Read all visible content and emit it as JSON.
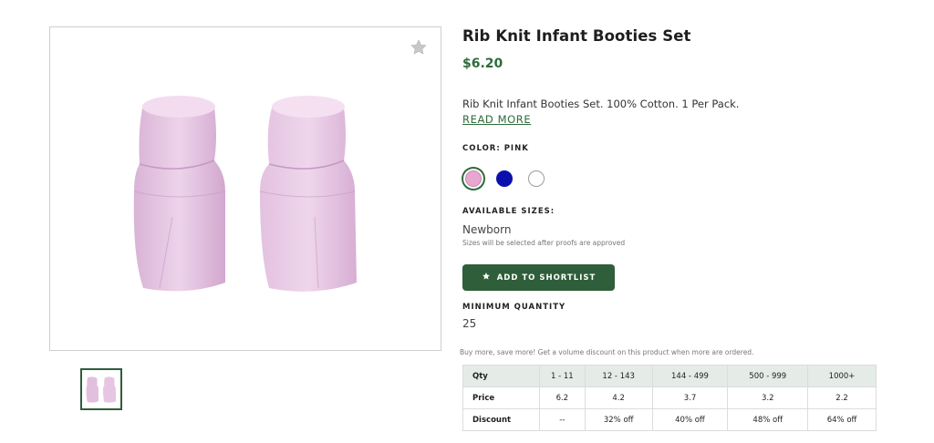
{
  "product": {
    "title": "Rib Knit Infant Booties Set",
    "price": "$6.20",
    "description": "Rib Knit Infant Booties Set. 100% Cotton. 1 Per Pack.",
    "read_more": "READ MORE"
  },
  "color": {
    "label": "COLOR: PINK",
    "swatches": [
      {
        "name": "pink",
        "hex": "#e8a7cf",
        "selected": true
      },
      {
        "name": "royal-blue",
        "hex": "#0a0fae",
        "selected": false
      },
      {
        "name": "white",
        "hex": "#ffffff",
        "selected": false
      }
    ]
  },
  "sizes": {
    "label": "AVAILABLE SIZES:",
    "value": "Newborn",
    "note": "Sizes will be selected after proofs are approved"
  },
  "shortlist": {
    "label": "ADD TO SHORTLIST",
    "icon": "star-icon"
  },
  "minimum": {
    "label": "MINIMUM QUANTITY",
    "value": "25"
  },
  "volume_note": "Buy more, save more! Get a volume discount on this product when more are ordered.",
  "pricing_table": {
    "header": [
      "Qty",
      "1 - 11",
      "12 - 143",
      "144 - 499",
      "500 - 999",
      "1000+"
    ],
    "rows": [
      [
        "Price",
        "6.2",
        "4.2",
        "3.7",
        "3.2",
        "2.2"
      ],
      [
        "Discount",
        "--",
        "32% off",
        "40% off",
        "48% off",
        "64% off"
      ]
    ]
  },
  "gallery": {
    "favorite_icon": "star-icon",
    "image": "pink-booties"
  },
  "colors": {
    "accent": "#2e5e3a",
    "price": "#2f6b3b",
    "table_header": "#e5ebe6"
  }
}
